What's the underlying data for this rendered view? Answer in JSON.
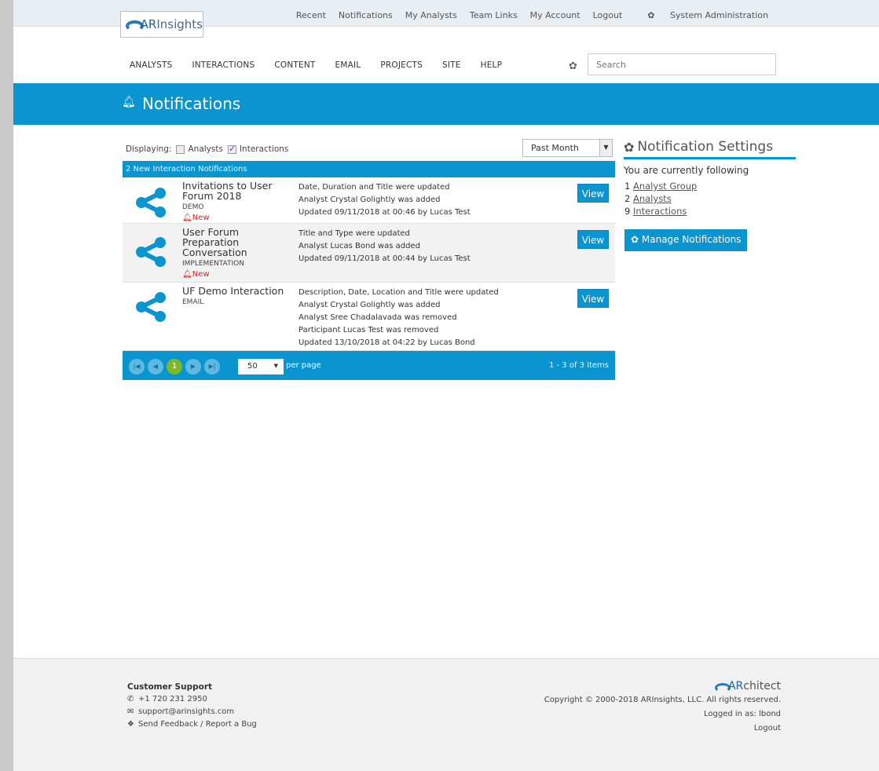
{
  "top_links": [
    "Recent",
    "Notifications",
    "My Analysts",
    "Team Links",
    "My Account",
    "Logout",
    "System Administration"
  ],
  "logo": {
    "prefix": "AR",
    "suffix": "Insights"
  },
  "main_nav": [
    "ANALYSTS",
    "INTERACTIONS",
    "CONTENT",
    "EMAIL",
    "PROJECTS",
    "SITE",
    "HELP"
  ],
  "search": {
    "placeholder": "Search"
  },
  "banner": {
    "title": "Notifications"
  },
  "filter": {
    "label": "Displaying:",
    "analysts_label": "Analysts",
    "analysts_checked": false,
    "interactions_label": "Interactions",
    "interactions_checked": true
  },
  "period": {
    "selected": "Past Month"
  },
  "panel": {
    "header": "2 New Interaction Notifications",
    "rows": [
      {
        "name": "Invitations to User Forum 2018",
        "type": "DEMO",
        "new": "New",
        "details": [
          "Date, Duration and Title were updated",
          "Analyst Crystal Golightly was added",
          "Updated 09/11/2018 at 00:46 by Lucas Test"
        ],
        "view": "View"
      },
      {
        "name": "User Forum Preparation Conversation",
        "type": "IMPLEMENTATION",
        "new": "New",
        "details": [
          "Title and Type were updated",
          "Analyst Lucas Bond was added",
          "Updated 09/11/2018 at 00:44 by Lucas Test"
        ],
        "view": "View"
      },
      {
        "name": "UF Demo Interaction",
        "type": "EMAIL",
        "new": "",
        "details": [
          "Description, Date, Location and Title were updated",
          "Analyst Crystal Golightly was added",
          "Analyst Sree Chadalavada was removed",
          "Participant Lucas Test was removed",
          "Updated 13/10/2018 at 04:22 by Lucas Bond"
        ],
        "view": "View"
      }
    ],
    "pager": {
      "current_page": "1",
      "per_page": "50",
      "per_page_label": "per page",
      "range": "1 - 3 of 3 items"
    }
  },
  "settings": {
    "title": "Notification Settings",
    "following_label": "You are currently following",
    "items": [
      {
        "count": "1",
        "label": "Analyst Group"
      },
      {
        "count": "2",
        "label": "Analysts"
      },
      {
        "count": "9",
        "label": "Interactions"
      }
    ],
    "manage_label": "Manage Notifications"
  },
  "footer": {
    "support_title": "Customer Support",
    "phone": "+1 720 231 2950",
    "email": "support@arinsights.com",
    "feedback": "Send Feedback / Report a Bug",
    "logo_prefix": "AR",
    "logo_suffix": "chitect",
    "copyright": "Copyright © 2000-2018 ARInsights, LLC. All rights reserved.",
    "logged_in": "Logged in as: lbond",
    "logout": "Logout"
  },
  "colors": {
    "accent": "#0a94d0",
    "new_badge": "#e31b1b",
    "current_page": "#7eb822"
  }
}
